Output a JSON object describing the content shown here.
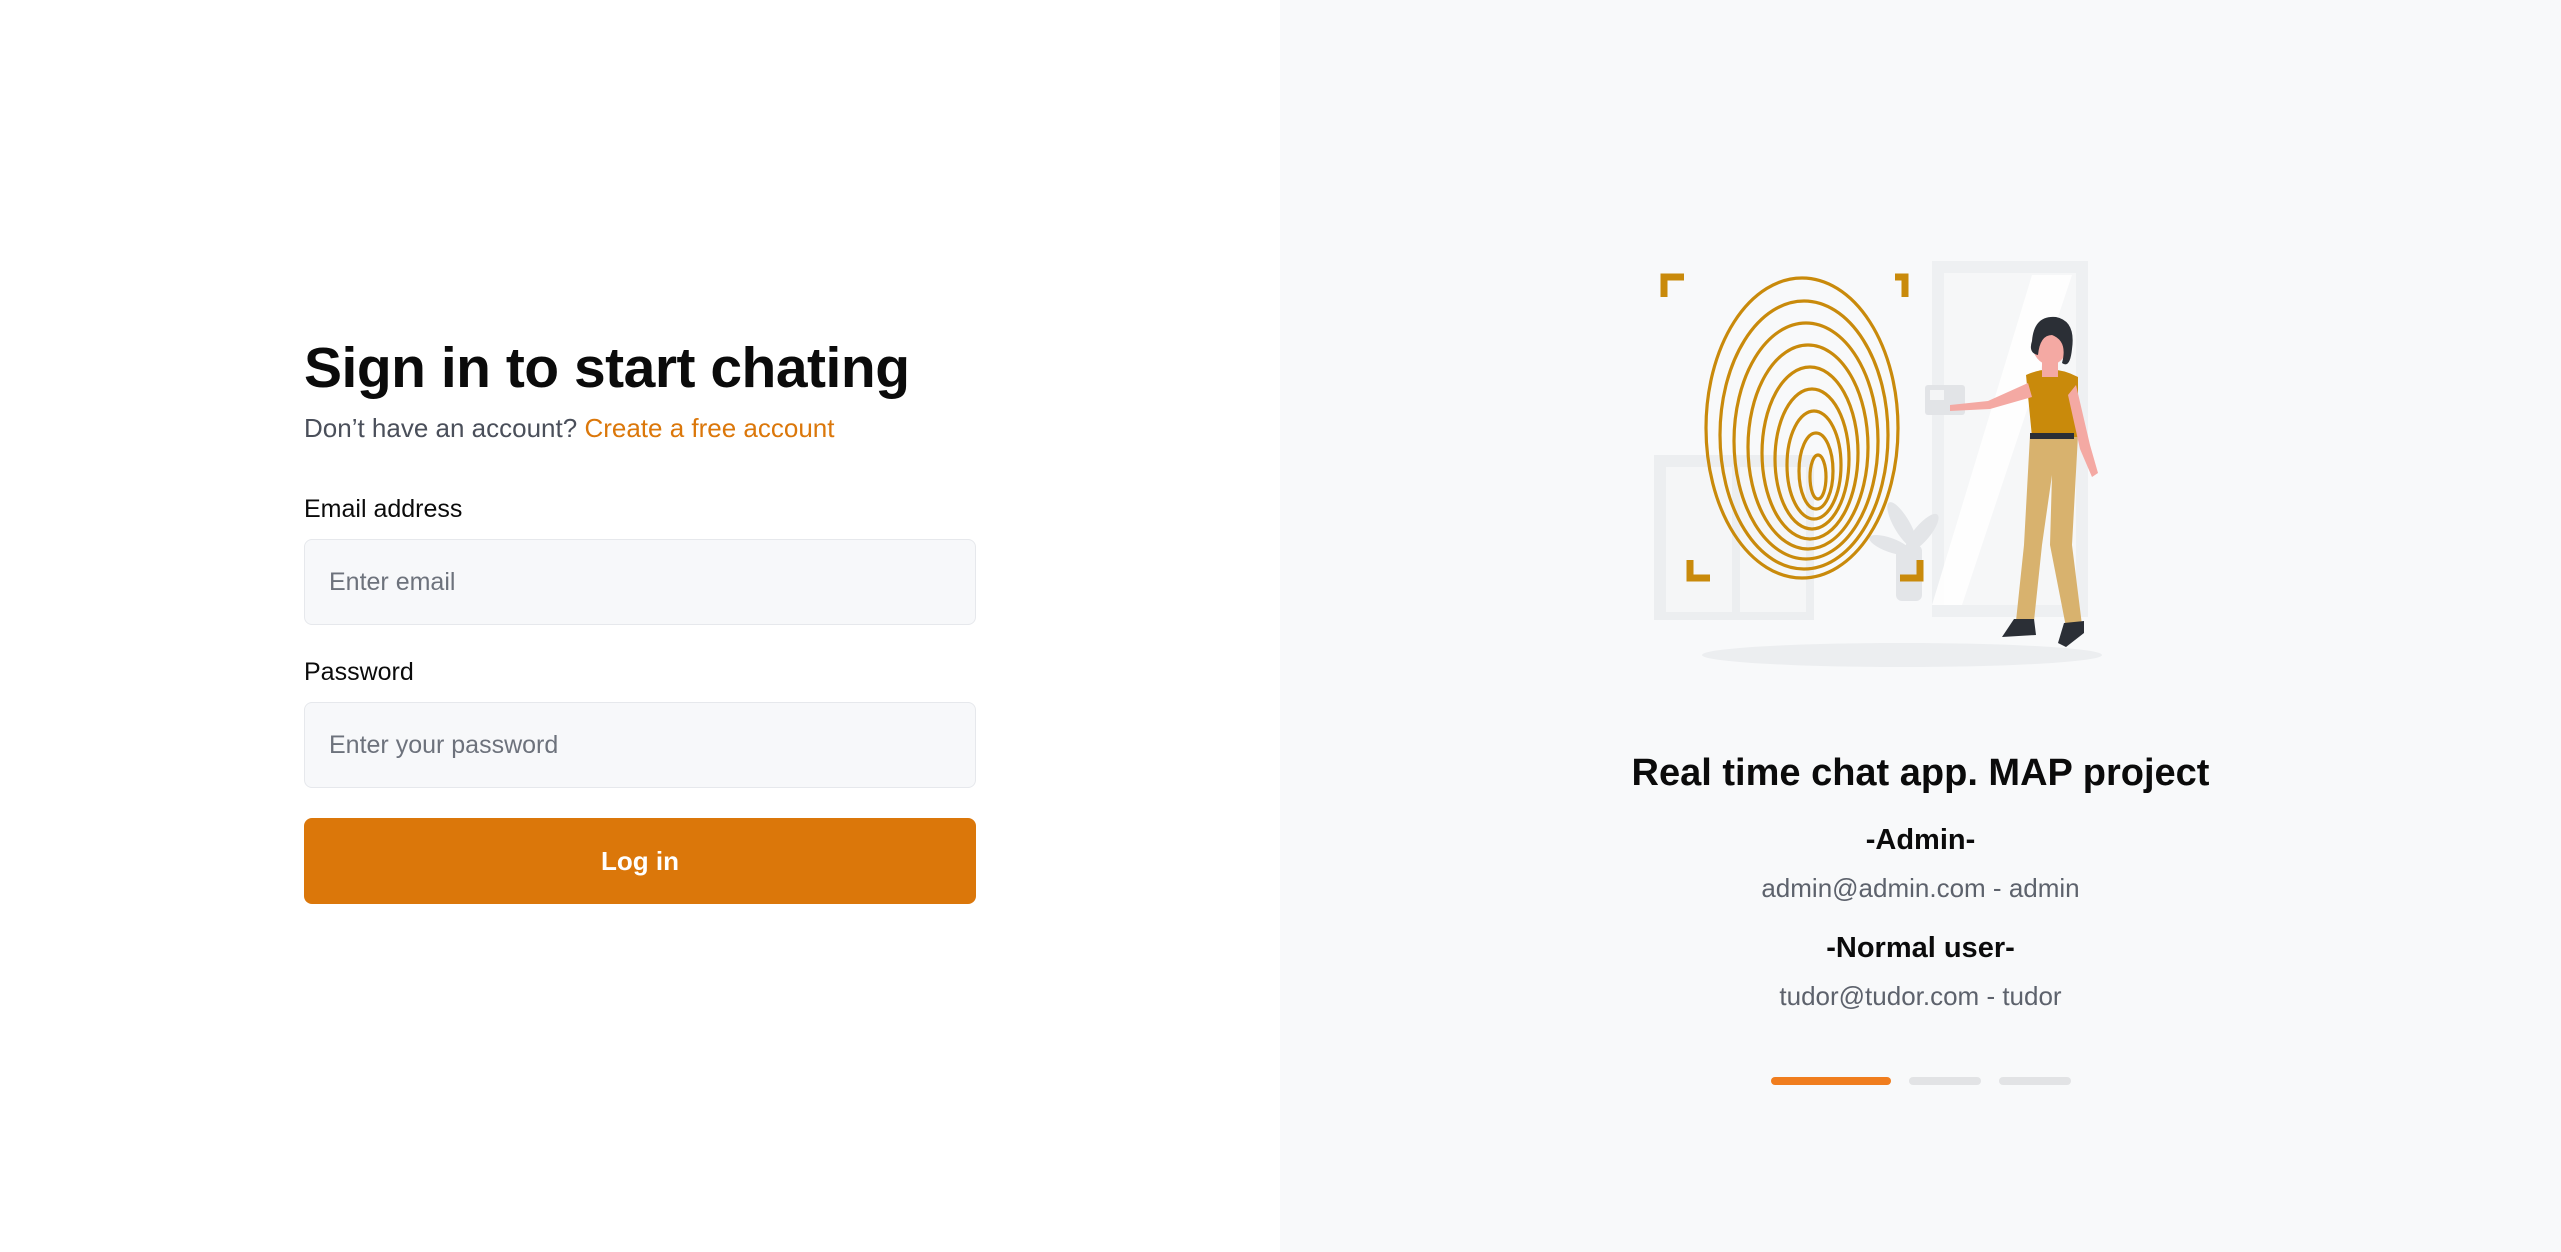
{
  "login": {
    "title": "Sign in to start chating",
    "signup_prompt": "Don’t have an account?",
    "signup_link": "Create a free account",
    "email_label": "Email address",
    "email_placeholder": "Enter email",
    "email_value": "",
    "password_label": "Password",
    "password_placeholder": "Enter your password",
    "password_value": "",
    "submit_label": "Log in"
  },
  "showcase": {
    "illustration": "fingerprint-login-illustration",
    "title": "Real time chat app. MAP project",
    "admin_heading": "-Admin-",
    "admin_credentials": "admin@admin.com - admin",
    "user_heading": "-Normal user-",
    "user_credentials": "tudor@tudor.com - tudor",
    "carousel_count": 3,
    "carousel_active_index": 0
  },
  "colors": {
    "accent": "#db770a",
    "carousel_active": "#f07d1e",
    "panel_bg": "#f8f9fa",
    "illustration_gold": "#c98a0b"
  }
}
